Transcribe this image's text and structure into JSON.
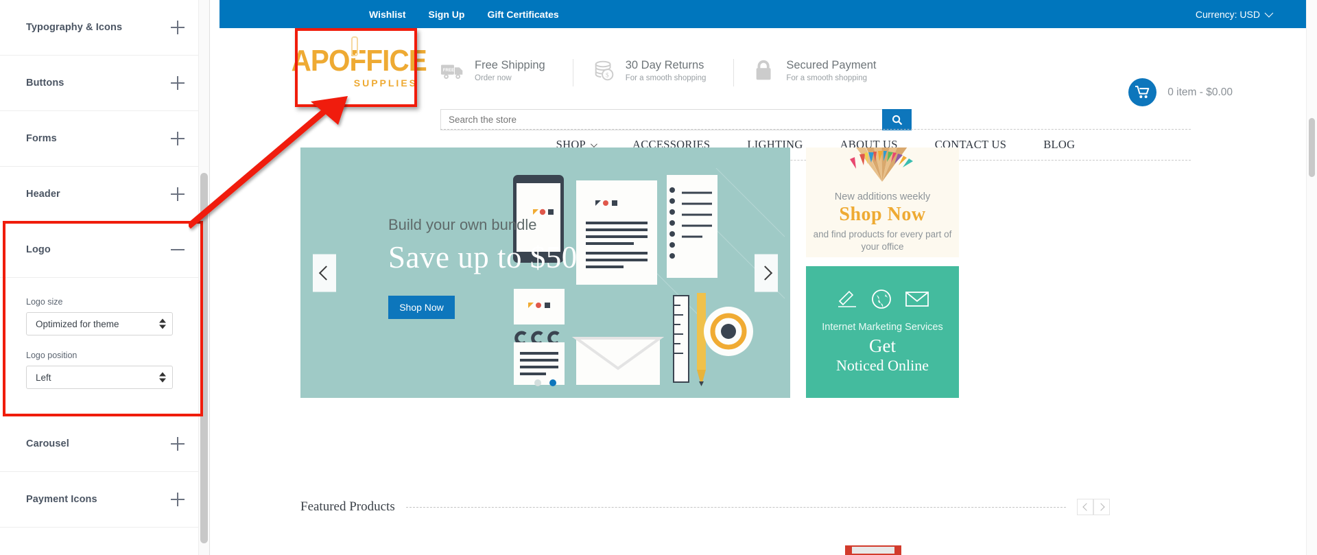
{
  "sidebar": {
    "panels": [
      {
        "label": "Typography & Icons",
        "state": "collapsed",
        "icon": "plus-icon"
      },
      {
        "label": "Buttons",
        "state": "collapsed",
        "icon": "plus-icon"
      },
      {
        "label": "Forms",
        "state": "collapsed",
        "icon": "plus-icon"
      },
      {
        "label": "Header",
        "state": "collapsed",
        "icon": "plus-icon"
      },
      {
        "label": "Logo",
        "state": "expanded",
        "icon": "minus-icon"
      },
      {
        "label": "Carousel",
        "state": "collapsed",
        "icon": "plus-icon"
      },
      {
        "label": "Payment Icons",
        "state": "collapsed",
        "icon": "plus-icon"
      }
    ],
    "logo_panel": {
      "size_label": "Logo size",
      "size_value": "Optimized for theme",
      "position_label": "Logo position",
      "position_value": "Left"
    },
    "highlight_color": "#f01c0b"
  },
  "topbar": {
    "links": [
      "Wishlist",
      "Sign Up",
      "Gift Certificates"
    ],
    "currency": "Currency: USD",
    "background": "#0076bd"
  },
  "header": {
    "logo": {
      "main": "APOFFICE",
      "sub": "SUPPLIES",
      "color": "#eeaa33"
    },
    "promos": [
      {
        "icon": "truck-icon",
        "title": "Free Shipping",
        "sub": "Order now"
      },
      {
        "icon": "coins-icon",
        "title": "30 Day Returns",
        "sub": "For a smooth shopping"
      },
      {
        "icon": "lock-icon",
        "title": "Secured Payment",
        "sub": "For a smooth shopping"
      }
    ],
    "search": {
      "placeholder": "Search the store",
      "value": "",
      "button_icon": "search-icon"
    },
    "cart": {
      "icon": "cart-icon",
      "text": "0 item - $0.00"
    }
  },
  "nav": {
    "items": [
      {
        "label": "SHOP",
        "has_dropdown": true
      },
      {
        "label": "ACCESSORIES",
        "has_dropdown": false
      },
      {
        "label": "LIGHTING",
        "has_dropdown": false
      },
      {
        "label": "ABOUT US",
        "has_dropdown": false
      },
      {
        "label": "CONTACT US",
        "has_dropdown": false
      },
      {
        "label": "BLOG",
        "has_dropdown": false
      }
    ]
  },
  "hero": {
    "subtitle": "Build your own bundle",
    "title": "Save up to $50",
    "button": "Shop Now",
    "prev_icon": "chevron-left-icon",
    "next_icon": "chevron-right-icon",
    "dots": 2,
    "active_dot": 1,
    "background": "#9fcac6"
  },
  "cards": {
    "top": {
      "line1": "New additions weekly",
      "line2": "Shop Now",
      "line3": "and find products for every part of your office",
      "background": "#fdf9ef"
    },
    "bottom": {
      "icons": [
        "pen-icon",
        "globe-icon",
        "envelope-icon"
      ],
      "line1": "Internet Marketing Services",
      "line2": "Get",
      "line3": "Noticed Online",
      "background": "#44bb9e"
    }
  },
  "featured": {
    "title": "Featured Products",
    "prev_icon": "chevron-left-icon",
    "next_icon": "chevron-right-icon"
  }
}
